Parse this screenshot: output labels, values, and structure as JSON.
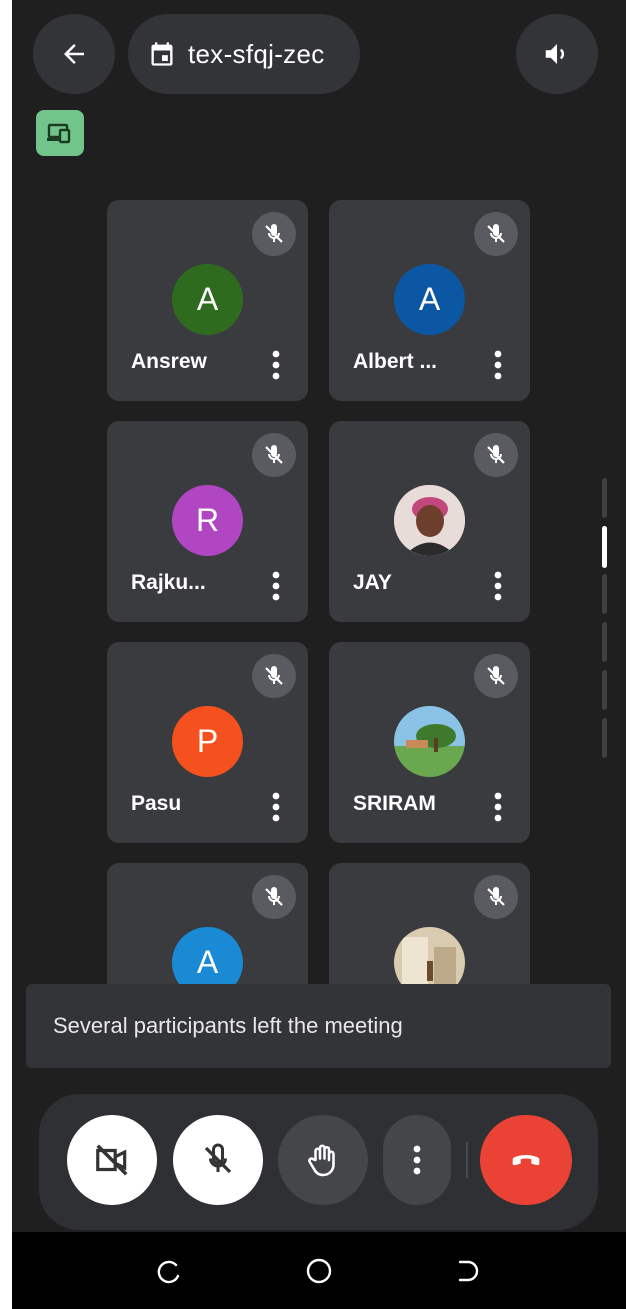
{
  "header": {
    "meeting_code": "tex-sfqj-zec",
    "back_icon": "arrow-left-icon",
    "calendar_icon": "calendar-icon",
    "speaker_icon": "speaker-icon",
    "cast_icon": "cast-devices-icon"
  },
  "participants": [
    {
      "name": "Ansrew",
      "initial": "A",
      "color": "#2e6b1f"
    },
    {
      "name": "Albert ...",
      "initial": "A",
      "color": "#0b57a4"
    },
    {
      "name": "Rajku...",
      "initial": "R",
      "color": "#b146c2"
    },
    {
      "name": "JAY",
      "initial": "",
      "color": "#c35a7a"
    },
    {
      "name": "Pasu",
      "initial": "P",
      "color": "#f4511e"
    },
    {
      "name": "SRIRAM",
      "initial": "",
      "color": "#5a9a3b"
    },
    {
      "name": "",
      "initial": "A",
      "color": "#1a8ad4"
    },
    {
      "name": "",
      "initial": "",
      "color": "#d8c9a7"
    }
  ],
  "toast": {
    "message": "Several participants left the meeting"
  },
  "controls": {
    "camera": "camera-off-icon",
    "mic": "mic-off-icon",
    "hand": "raise-hand-icon",
    "more": "more-vert-icon",
    "end_call": "end-call-icon",
    "end_call_color": "#ea4335"
  },
  "nav": {
    "recents": "recents-icon",
    "home": "home-icon",
    "back": "back-icon"
  }
}
